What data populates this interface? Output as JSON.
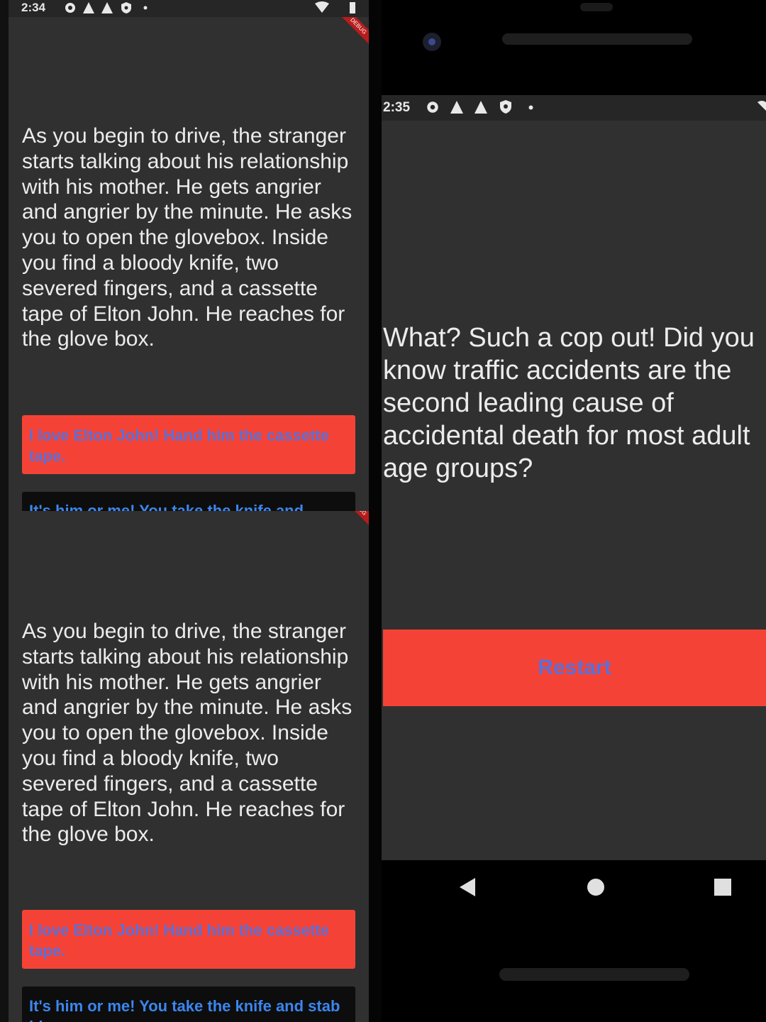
{
  "left_top": {
    "status_time": "2:34",
    "debug_banner": "DEBUG",
    "story_text": "As you begin to drive, the stranger starts talking about his relationship with his mother. He gets angrier and angrier by the minute. He asks you to open the glovebox. Inside you find a bloody knife, two severed fingers, and a cassette tape of Elton John. He reaches for the glove box.",
    "choice1_label": "I love Elton John! Hand him the cassette tape.",
    "choice2_label": "It's him or me! You take the knife and"
  },
  "left_bottom": {
    "debug_banner": "DEBUG",
    "story_text": "As you begin to drive, the stranger starts talking about his relationship with his mother. He gets angrier and angrier by the minute. He asks you to open the glovebox. Inside you find a bloody knife, two severed fingers, and a cassette tape of Elton John. He reaches for the glove box.",
    "choice1_label": "I love Elton John! Hand him the cassette tape.",
    "choice2_label": "It's him or me! You take the knife and stab him."
  },
  "right": {
    "status_time": "2:35",
    "story_text": "What? Such a cop out! Did you know traffic accidents are the second leading cause of accidental death for most adult age groups?",
    "restart_label": "Restart"
  },
  "colors": {
    "accent_red": "#f44336",
    "button_text": "#5b6fd8",
    "background": "#303030"
  }
}
